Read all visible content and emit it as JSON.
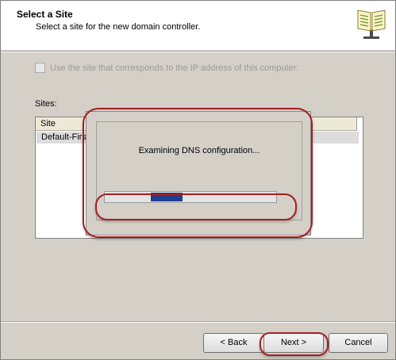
{
  "header": {
    "title": "Select a Site",
    "subtitle": "Select a site for the new domain controller.",
    "icon": "book-icon"
  },
  "form": {
    "use_ip_site_label": "Use the site that corresponds to the IP address of this computer.",
    "use_ip_site_checked": false,
    "use_ip_site_enabled": false,
    "sites_label": "Sites:"
  },
  "sites_table": {
    "columns": [
      "Site"
    ],
    "rows": [
      {
        "site": "Default-First-"
      }
    ]
  },
  "progress": {
    "message": "Examining DNS configuration...",
    "bar_color": "#1f3f8f"
  },
  "buttons": {
    "back": "< Back",
    "next": "Next >",
    "cancel": "Cancel"
  },
  "annotation_color": "#a51e22"
}
